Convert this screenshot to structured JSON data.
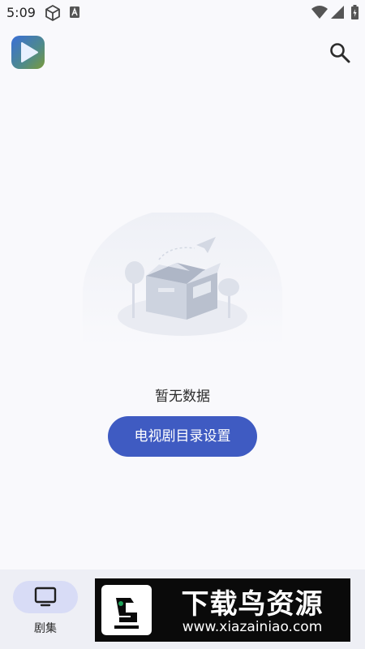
{
  "status_bar": {
    "time": "5:09",
    "icons": [
      "cube-icon",
      "a-notification-icon",
      "wifi-icon",
      "signal-icon",
      "battery-icon"
    ]
  },
  "app_bar": {
    "logo": "play-logo-icon",
    "search": "search-icon"
  },
  "empty_state": {
    "illustration": "empty-box-illustration",
    "text": "暂无数据",
    "button_label": "电视剧目录设置"
  },
  "bottom_nav": {
    "items": [
      {
        "label": "剧集",
        "icon": "tv-icon",
        "active": true
      }
    ]
  },
  "watermark": {
    "title": "下载鸟资源",
    "url": "www.xiazainiao.com"
  },
  "colors": {
    "background": "#f9f9fc",
    "accent": "#3f5bc2",
    "nav_background": "#eeeff5",
    "nav_active_pill": "#d8dcf6",
    "watermark_background": "#0a0a0a"
  }
}
